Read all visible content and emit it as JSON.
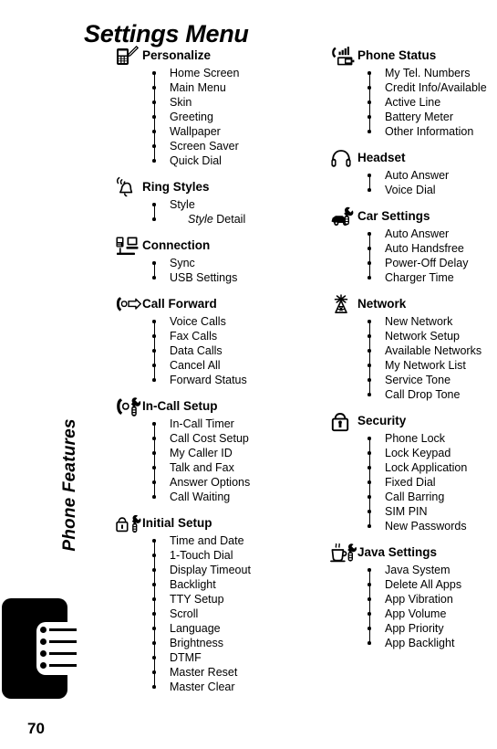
{
  "page": {
    "title": "Settings Menu",
    "side_title": "Phone Features",
    "page_number": "70"
  },
  "columns": {
    "left": [
      {
        "icon": "phone-pencil-icon",
        "label": "Personalize",
        "items": [
          {
            "text": "Home Screen"
          },
          {
            "text": "Main Menu"
          },
          {
            "text": "Skin"
          },
          {
            "text": "Greeting"
          },
          {
            "text": "Wallpaper"
          },
          {
            "text": "Screen Saver"
          },
          {
            "text": "Quick Dial"
          }
        ]
      },
      {
        "icon": "ringing-bell-icon",
        "label": "Ring Styles",
        "items": [
          {
            "text": "Style"
          },
          {
            "text": "Style Detail",
            "sub": true,
            "italic_prefix": "Style",
            "rest": " Detail"
          }
        ]
      },
      {
        "icon": "phone-computer-icon",
        "label": "Connection",
        "items": [
          {
            "text": "Sync"
          },
          {
            "text": "USB Settings"
          }
        ]
      },
      {
        "icon": "handset-arrow-icon",
        "label": "Call Forward",
        "items": [
          {
            "text": "Voice Calls"
          },
          {
            "text": "Fax Calls"
          },
          {
            "text": "Data Calls"
          },
          {
            "text": "Cancel All"
          },
          {
            "text": "Forward Status"
          }
        ]
      },
      {
        "icon": "handset-wrench-icon",
        "label": "In-Call Setup",
        "items": [
          {
            "text": "In-Call Timer"
          },
          {
            "text": "Call Cost Setup"
          },
          {
            "text": "My Caller ID"
          },
          {
            "text": "Talk and Fax"
          },
          {
            "text": "Answer Options"
          },
          {
            "text": "Call Waiting"
          }
        ]
      },
      {
        "icon": "lock-wrench-icon",
        "label": "Initial Setup",
        "items": [
          {
            "text": "Time and Date"
          },
          {
            "text": "1-Touch Dial"
          },
          {
            "text": "Display Timeout"
          },
          {
            "text": "Backlight"
          },
          {
            "text": "TTY Setup"
          },
          {
            "text": "Scroll"
          },
          {
            "text": "Language"
          },
          {
            "text": "Brightness"
          },
          {
            "text": "DTMF"
          },
          {
            "text": "Master Reset"
          },
          {
            "text": "Master Clear"
          }
        ]
      }
    ],
    "right": [
      {
        "icon": "phone-battery-signal-icon",
        "label": "Phone Status",
        "items": [
          {
            "text": "My Tel. Numbers"
          },
          {
            "text": "Credit Info/Available"
          },
          {
            "text": "Active Line"
          },
          {
            "text": "Battery Meter"
          },
          {
            "text": "Other Information"
          }
        ]
      },
      {
        "icon": "headphones-icon",
        "label": "Headset",
        "items": [
          {
            "text": "Auto Answer"
          },
          {
            "text": "Voice Dial"
          }
        ]
      },
      {
        "icon": "car-wrench-icon",
        "label": "Car Settings",
        "items": [
          {
            "text": "Auto Answer"
          },
          {
            "text": "Auto Handsfree"
          },
          {
            "text": "Power-Off Delay"
          },
          {
            "text": "Charger Time"
          }
        ]
      },
      {
        "icon": "antenna-tower-icon",
        "label": "Network",
        "items": [
          {
            "text": "New Network"
          },
          {
            "text": "Network Setup"
          },
          {
            "text": "Available Networks"
          },
          {
            "text": "My Network List"
          },
          {
            "text": "Service Tone"
          },
          {
            "text": "Call Drop Tone"
          }
        ]
      },
      {
        "icon": "padlock-icon",
        "label": "Security",
        "items": [
          {
            "text": "Phone Lock"
          },
          {
            "text": "Lock Keypad"
          },
          {
            "text": "Lock Application"
          },
          {
            "text": "Fixed Dial"
          },
          {
            "text": "Call Barring"
          },
          {
            "text": "SIM PIN"
          },
          {
            "text": "New Passwords"
          }
        ]
      },
      {
        "icon": "coffee-wrench-icon",
        "label": "Java Settings",
        "items": [
          {
            "text": "Java System"
          },
          {
            "text": "Delete All Apps"
          },
          {
            "text": "App Vibration"
          },
          {
            "text": "App Volume"
          },
          {
            "text": "App Priority"
          },
          {
            "text": "App Backlight"
          }
        ]
      }
    ]
  },
  "edge_tab": {
    "dot_count": 4
  },
  "colors": {
    "ink": "#000000",
    "paper": "#ffffff"
  }
}
